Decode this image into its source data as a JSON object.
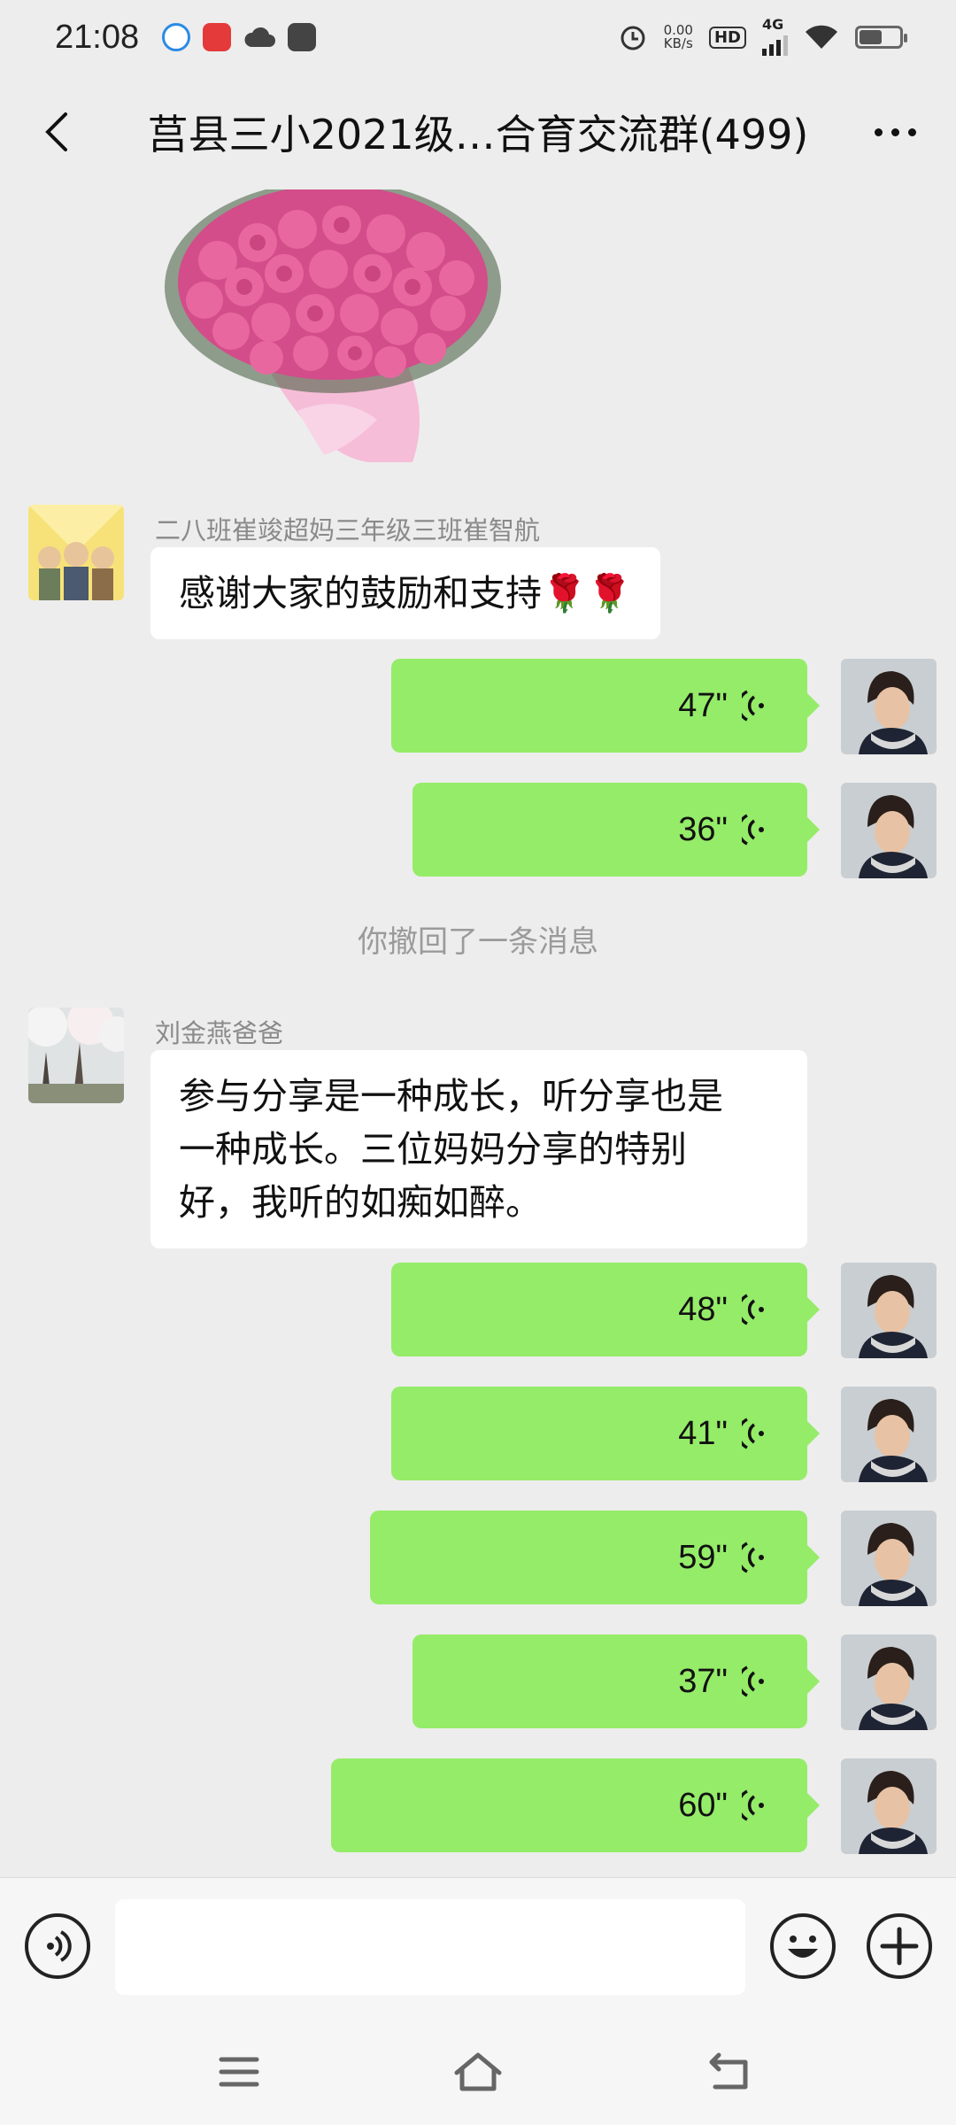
{
  "status_bar": {
    "time": "21:08",
    "net_speed_value": "0.00",
    "net_speed_unit": "KB/s",
    "hd_label": "HD",
    "network_type": "4G",
    "icons": [
      "browser-app-icon",
      "heart-app-icon",
      "cloud-icon",
      "bag-app-icon",
      "alarm-icon",
      "signal-icon",
      "wifi-icon",
      "battery-icon"
    ],
    "battery_level": 0.55
  },
  "header": {
    "title": "莒县三小2021级…合育交流群(499)",
    "back_icon": "chevron-left-icon",
    "more_icon": "more-dots-icon"
  },
  "messages": [
    {
      "type": "image-sticker",
      "content": "rose-bouquet-sticker"
    },
    {
      "type": "text",
      "side": "left",
      "sender": "二八班崔竣超妈三年级三班崔智航",
      "text": "感谢大家的鼓励和支持🌹🌹"
    },
    {
      "type": "voice",
      "side": "right",
      "duration": "47\""
    },
    {
      "type": "voice",
      "side": "right",
      "duration": "36\""
    },
    {
      "type": "system",
      "text": "你撤回了一条消息"
    },
    {
      "type": "text",
      "side": "left",
      "sender": "刘金燕爸爸",
      "lines": [
        "参与分享是一种成长，听分享也是",
        "一种成长。三位妈妈分享的特别",
        "好，我听的如痴如醉。"
      ]
    },
    {
      "type": "voice",
      "side": "right",
      "duration": "48\""
    },
    {
      "type": "voice",
      "side": "right",
      "duration": "41\""
    },
    {
      "type": "voice",
      "side": "right",
      "duration": "59\""
    },
    {
      "type": "voice",
      "side": "right",
      "duration": "37\""
    },
    {
      "type": "voice",
      "side": "right",
      "duration": "60\""
    }
  ],
  "input_bar": {
    "placeholder": "",
    "value": ""
  },
  "colors": {
    "background": "#ededed",
    "voice_bubble": "#95ec69",
    "text_bubble": "#ffffff",
    "system_text": "#9a9a9a"
  }
}
